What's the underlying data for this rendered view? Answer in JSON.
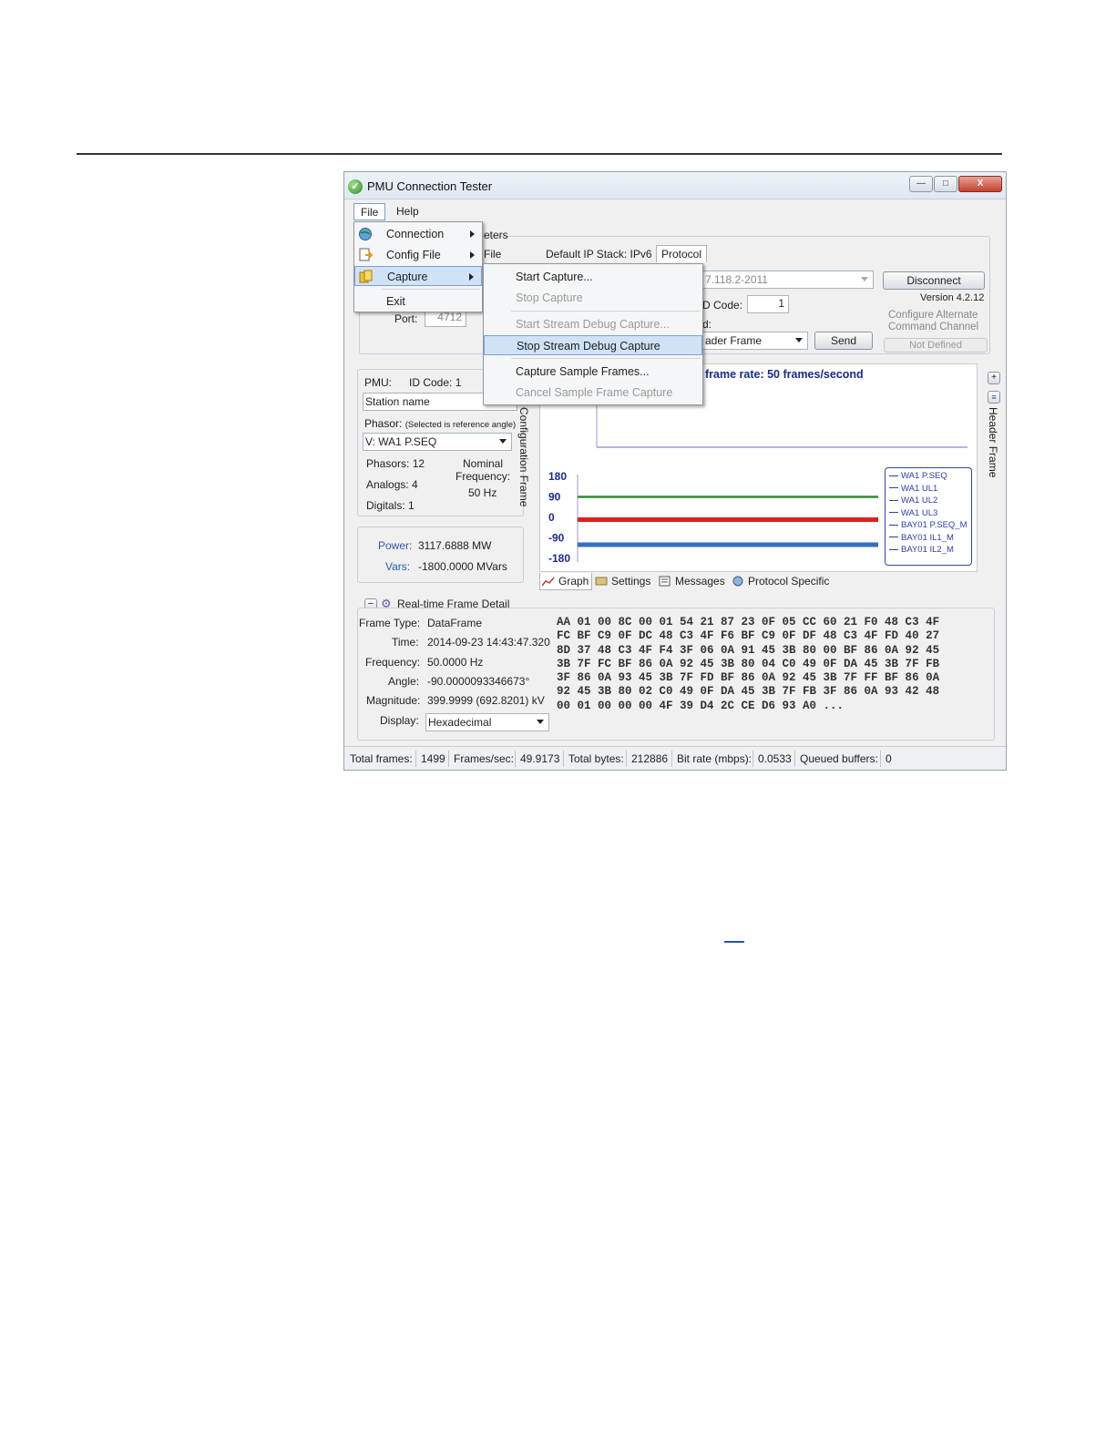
{
  "window": {
    "title": "PMU Connection Tester",
    "controls": {
      "minimize": "—",
      "maximize": "□",
      "close": "X"
    }
  },
  "menubar": {
    "file": "File",
    "help": "Help"
  },
  "file_menu": {
    "items": [
      {
        "label": "Connection",
        "icon": "globe-icon",
        "submenu": true
      },
      {
        "label": "Config File",
        "icon": "config-file-icon",
        "submenu": true
      },
      {
        "label": "Capture",
        "icon": "capture-icon",
        "submenu": true,
        "highlighted": true
      },
      {
        "label": "Exit"
      }
    ]
  },
  "capture_menu": {
    "items": [
      {
        "label": "Start Capture...",
        "enabled": true
      },
      {
        "label": "Stop Capture",
        "enabled": false
      },
      {
        "label": "Start Stream Debug Capture...",
        "enabled": false
      },
      {
        "label": "Stop Stream Debug Capture",
        "enabled": true,
        "highlighted": true
      },
      {
        "label": "Capture Sample Frames...",
        "enabled": true
      },
      {
        "label": "Cancel Sample Frame Capture",
        "enabled": false
      }
    ]
  },
  "connection": {
    "parameters_partial": "eters",
    "file_partial": "File",
    "ip_stack": "Default IP Stack: IPv6",
    "protocol_tab": "Protocol",
    "protocol_value_partial": "7.118.2-2011",
    "id_code_label_partial": "D Code:",
    "id_code_value": "1",
    "command_label_partial": "d:",
    "command_value_partial": "ader Frame",
    "port_label": "Port:",
    "port_value": "4712",
    "disconnect": "Disconnect",
    "send": "Send",
    "version": "Version 4.2.12",
    "alt_channel_line1": "Configure Alternate",
    "alt_channel_line2": "Command Channel",
    "not_defined": "Not Defined"
  },
  "pmu": {
    "pmu_label": "PMU:",
    "id_code": "ID Code:  1",
    "station_name": "Station name",
    "phasor_label": "Phasor:",
    "phasor_note": "(Selected is reference angle)",
    "phasor_value": "V: WA1 P.SEQ",
    "phasors": "Phasors:  12",
    "analogs": "Analogs:  4",
    "digitals": "Digitals:  1",
    "nominal_label_1": "Nominal",
    "nominal_label_2": "Frequency:",
    "nominal_value": "50 Hz",
    "config_frame_label": "Configuration Frame",
    "header_frame_label": "Header Frame"
  },
  "power": {
    "power_label": "Power:",
    "power_value": "3117.6888 MW",
    "vars_label": "Vars:",
    "vars_value": "-1800.0000 MVars"
  },
  "graph": {
    "frame_rate_partial": "frame rate: 50 frames/second",
    "tabs": [
      "Graph",
      "Settings",
      "Messages",
      "Protocol Specific"
    ]
  },
  "chart_data": {
    "type": "line",
    "ylim": [
      -180,
      180
    ],
    "yticks": [
      "180",
      "90",
      "0",
      "-90",
      "-180"
    ],
    "series": [
      {
        "name": "WA1 P.SEQ",
        "color": "#2e8b2e",
        "values": [
          90,
          90
        ]
      },
      {
        "name": "WA1 UL1",
        "color": "#e02020",
        "values": [
          -5,
          -5
        ]
      },
      {
        "name": "WA1 UL2",
        "color": "#e02020",
        "values": [
          -15,
          -15
        ]
      },
      {
        "name": "WA1 UL3",
        "color": "#3070c0",
        "values": [
          -115,
          -115
        ]
      },
      {
        "name": "BAY01 P.SEQ_M",
        "color": "#3070c0",
        "values": [
          -125,
          -125
        ]
      },
      {
        "name": "BAY01 IL1_M",
        "color": "#a0a0d0",
        "values": []
      },
      {
        "name": "BAY01 IL2_M",
        "color": "#a0a0d0",
        "values": []
      }
    ]
  },
  "frame_detail": {
    "section_title": "Real-time Frame Detail",
    "collapse_glyph": "−",
    "frame_type_label": "Frame Type:",
    "frame_type_value": "DataFrame",
    "time_label": "Time:",
    "time_value": "2014-09-23 14:43:47.320",
    "frequency_label": "Frequency:",
    "frequency_value": "50.0000 Hz",
    "angle_label": "Angle:",
    "angle_value": "-90.0000093346673°",
    "magnitude_label": "Magnitude:",
    "magnitude_value": "399.9999 (692.8201) kV",
    "display_label": "Display:",
    "display_value": "Hexadecimal",
    "hex_lines": [
      "AA 01 00 8C 00 01 54 21 87 23 0F 05 CC 60 21 F0 48 C3 4F",
      "FC BF C9 0F DC 48 C3 4F F6 BF C9 0F DF 48 C3 4F FD 40 27",
      "8D 37 48 C3 4F F4 3F 06 0A 91 45 3B 80 00 BF 86 0A 92 45",
      "3B 7F FC BF 86 0A 92 45 3B 80 04 C0 49 0F DA 45 3B 7F FB",
      "3F 86 0A 93 45 3B 7F FD BF 86 0A 92 45 3B 7F FF BF 86 0A",
      "92 45 3B 80 02 C0 49 0F DA 45 3B 7F FB 3F 86 0A 93 42 48",
      "00 01 00 00 00 4F 39 D4 2C CE D6 93 A0 ..."
    ]
  },
  "status_bar": {
    "total_frames_label": "Total frames:",
    "total_frames": "1499",
    "fps_label": "Frames/sec:",
    "fps": "49.9173",
    "total_bytes_label": "Total bytes:",
    "total_bytes": "212886",
    "bitrate_label": "Bit rate (mbps):",
    "bitrate": "0.0533",
    "queued_label": "Queued buffers:",
    "queued": "0"
  }
}
